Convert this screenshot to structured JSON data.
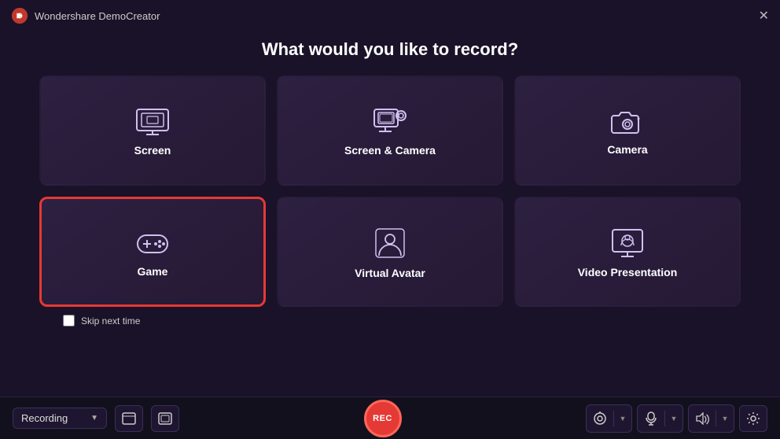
{
  "titleBar": {
    "appName": "Wondershare DemoCreator",
    "closeLabel": "✕"
  },
  "heading": "What would you like to record?",
  "cards": [
    {
      "id": "screen",
      "label": "Screen",
      "icon": "screen",
      "selected": false
    },
    {
      "id": "screen-camera",
      "label": "Screen & Camera",
      "icon": "screen-camera",
      "selected": false
    },
    {
      "id": "camera",
      "label": "Camera",
      "icon": "camera",
      "selected": false
    },
    {
      "id": "game",
      "label": "Game",
      "icon": "game",
      "selected": true
    },
    {
      "id": "virtual-avatar",
      "label": "Virtual Avatar",
      "icon": "avatar",
      "selected": false
    },
    {
      "id": "video-presentation",
      "label": "Video Presentation",
      "icon": "presentation",
      "selected": false
    }
  ],
  "skipLabel": "Skip next time",
  "toolbar": {
    "recordingDropdown": "Recording",
    "recButtonLabel": "REC"
  }
}
